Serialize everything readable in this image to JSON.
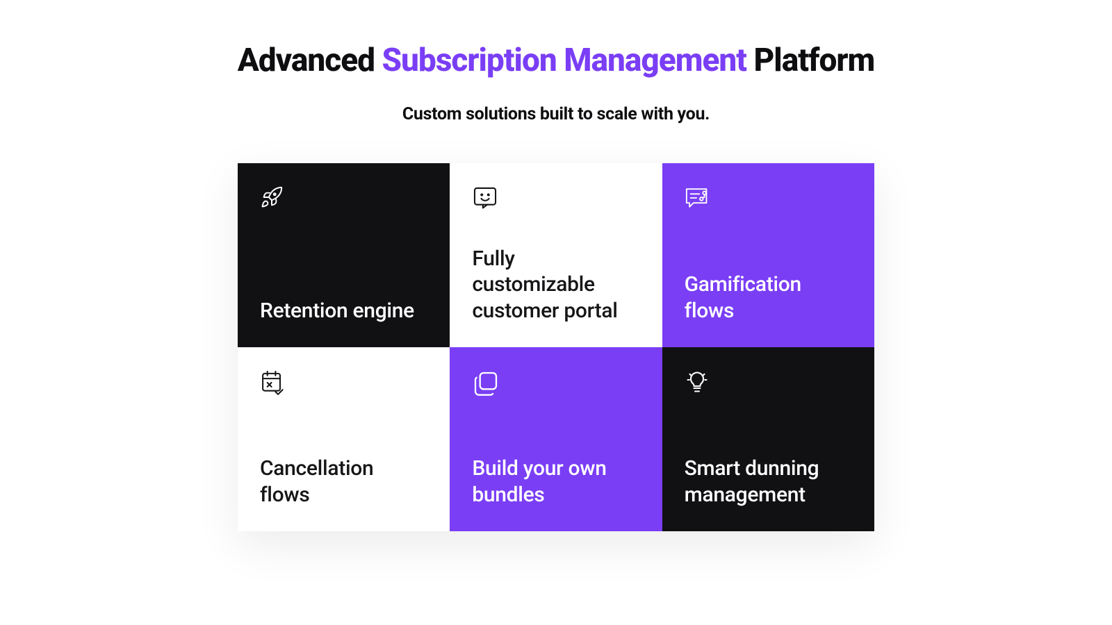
{
  "heading": {
    "part1": "Advanced ",
    "highlight": "Subscription Management",
    "part2": " Platform"
  },
  "subheading": "Custom solutions built to scale with you.",
  "tiles": [
    {
      "title": "Retention engine",
      "variant": "dark",
      "icon": "rocket-icon"
    },
    {
      "title": "Fully customizable customer portal",
      "variant": "white",
      "icon": "smile-chat-icon"
    },
    {
      "title": "Gamification flows",
      "variant": "purple",
      "icon": "flow-card-icon"
    },
    {
      "title": "Cancellation flows",
      "variant": "white",
      "icon": "calendar-cancel-icon"
    },
    {
      "title": "Build your own bundles",
      "variant": "purple",
      "icon": "stack-icon"
    },
    {
      "title": "Smart dunning management",
      "variant": "dark",
      "icon": "lightbulb-icon"
    }
  ],
  "colors": {
    "accent": "#7a3ef5",
    "dark": "#111114",
    "text": "#0e0e10"
  }
}
